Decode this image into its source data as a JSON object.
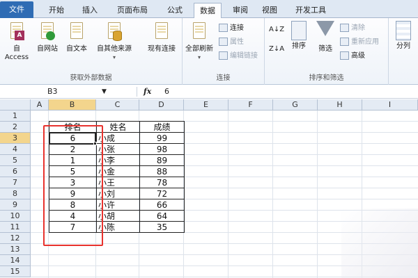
{
  "tabs": [
    "文件",
    "开始",
    "插入",
    "页面布局",
    "公式",
    "数据",
    "审阅",
    "视图",
    "开发工具"
  ],
  "ribbon": {
    "get_external": {
      "label": "获取外部数据",
      "buttons": [
        "自 Access",
        "自网站",
        "自文本",
        "自其他来源",
        "现有连接"
      ]
    },
    "connections": {
      "label": "连接",
      "refresh_all": "全部刷新",
      "connections": "连接",
      "properties": "属性",
      "edit_links": "编辑链接"
    },
    "sort_filter": {
      "label": "排序和筛选",
      "sort": "排序",
      "filter": "筛选",
      "clear": "清除",
      "reapply": "重新应用",
      "advanced": "高级"
    },
    "data_tools": {
      "split": "分列"
    }
  },
  "formula_bar": {
    "name_box": "B3",
    "fx": "fx",
    "value": "6"
  },
  "columns": [
    "A",
    "B",
    "C",
    "D",
    "E",
    "F",
    "G",
    "H",
    "I"
  ],
  "rows": [
    "1",
    "2",
    "3",
    "4",
    "5",
    "6",
    "7",
    "8",
    "9",
    "10",
    "11",
    "12",
    "13",
    "14",
    "15"
  ],
  "table": {
    "headers": [
      "排名",
      "姓名",
      "成绩"
    ],
    "rows": [
      [
        "6",
        "小成",
        "99"
      ],
      [
        "2",
        "小张",
        "98"
      ],
      [
        "1",
        "小李",
        "89"
      ],
      [
        "5",
        "小金",
        "88"
      ],
      [
        "3",
        "小王",
        "78"
      ],
      [
        "9",
        "小刘",
        "72"
      ],
      [
        "8",
        "小许",
        "66"
      ],
      [
        "4",
        "小胡",
        "64"
      ],
      [
        "7",
        "小陈",
        "35"
      ]
    ]
  },
  "colors": {
    "file_tab": "#2f6cb4",
    "highlight": "#e8322d",
    "selected_header": "#f3d58d"
  }
}
